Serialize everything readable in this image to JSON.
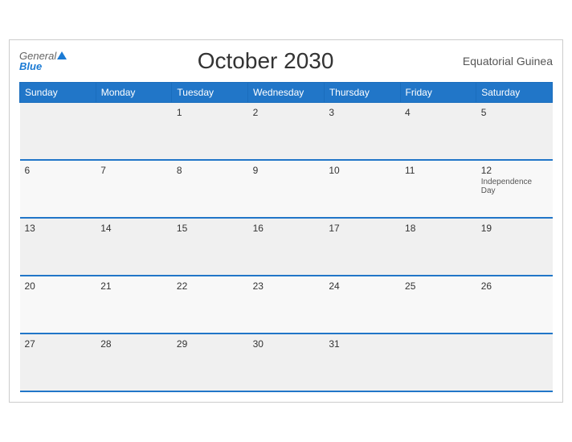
{
  "header": {
    "title": "October 2030",
    "country": "Equatorial Guinea",
    "logo_general": "General",
    "logo_blue": "Blue"
  },
  "days_of_week": [
    "Sunday",
    "Monday",
    "Tuesday",
    "Wednesday",
    "Thursday",
    "Friday",
    "Saturday"
  ],
  "weeks": [
    [
      {
        "date": "",
        "holiday": ""
      },
      {
        "date": "",
        "holiday": ""
      },
      {
        "date": "1",
        "holiday": ""
      },
      {
        "date": "2",
        "holiday": ""
      },
      {
        "date": "3",
        "holiday": ""
      },
      {
        "date": "4",
        "holiday": ""
      },
      {
        "date": "5",
        "holiday": ""
      }
    ],
    [
      {
        "date": "6",
        "holiday": ""
      },
      {
        "date": "7",
        "holiday": ""
      },
      {
        "date": "8",
        "holiday": ""
      },
      {
        "date": "9",
        "holiday": ""
      },
      {
        "date": "10",
        "holiday": ""
      },
      {
        "date": "11",
        "holiday": ""
      },
      {
        "date": "12",
        "holiday": "Independence Day"
      }
    ],
    [
      {
        "date": "13",
        "holiday": ""
      },
      {
        "date": "14",
        "holiday": ""
      },
      {
        "date": "15",
        "holiday": ""
      },
      {
        "date": "16",
        "holiday": ""
      },
      {
        "date": "17",
        "holiday": ""
      },
      {
        "date": "18",
        "holiday": ""
      },
      {
        "date": "19",
        "holiday": ""
      }
    ],
    [
      {
        "date": "20",
        "holiday": ""
      },
      {
        "date": "21",
        "holiday": ""
      },
      {
        "date": "22",
        "holiday": ""
      },
      {
        "date": "23",
        "holiday": ""
      },
      {
        "date": "24",
        "holiday": ""
      },
      {
        "date": "25",
        "holiday": ""
      },
      {
        "date": "26",
        "holiday": ""
      }
    ],
    [
      {
        "date": "27",
        "holiday": ""
      },
      {
        "date": "28",
        "holiday": ""
      },
      {
        "date": "29",
        "holiday": ""
      },
      {
        "date": "30",
        "holiday": ""
      },
      {
        "date": "31",
        "holiday": ""
      },
      {
        "date": "",
        "holiday": ""
      },
      {
        "date": "",
        "holiday": ""
      }
    ]
  ]
}
